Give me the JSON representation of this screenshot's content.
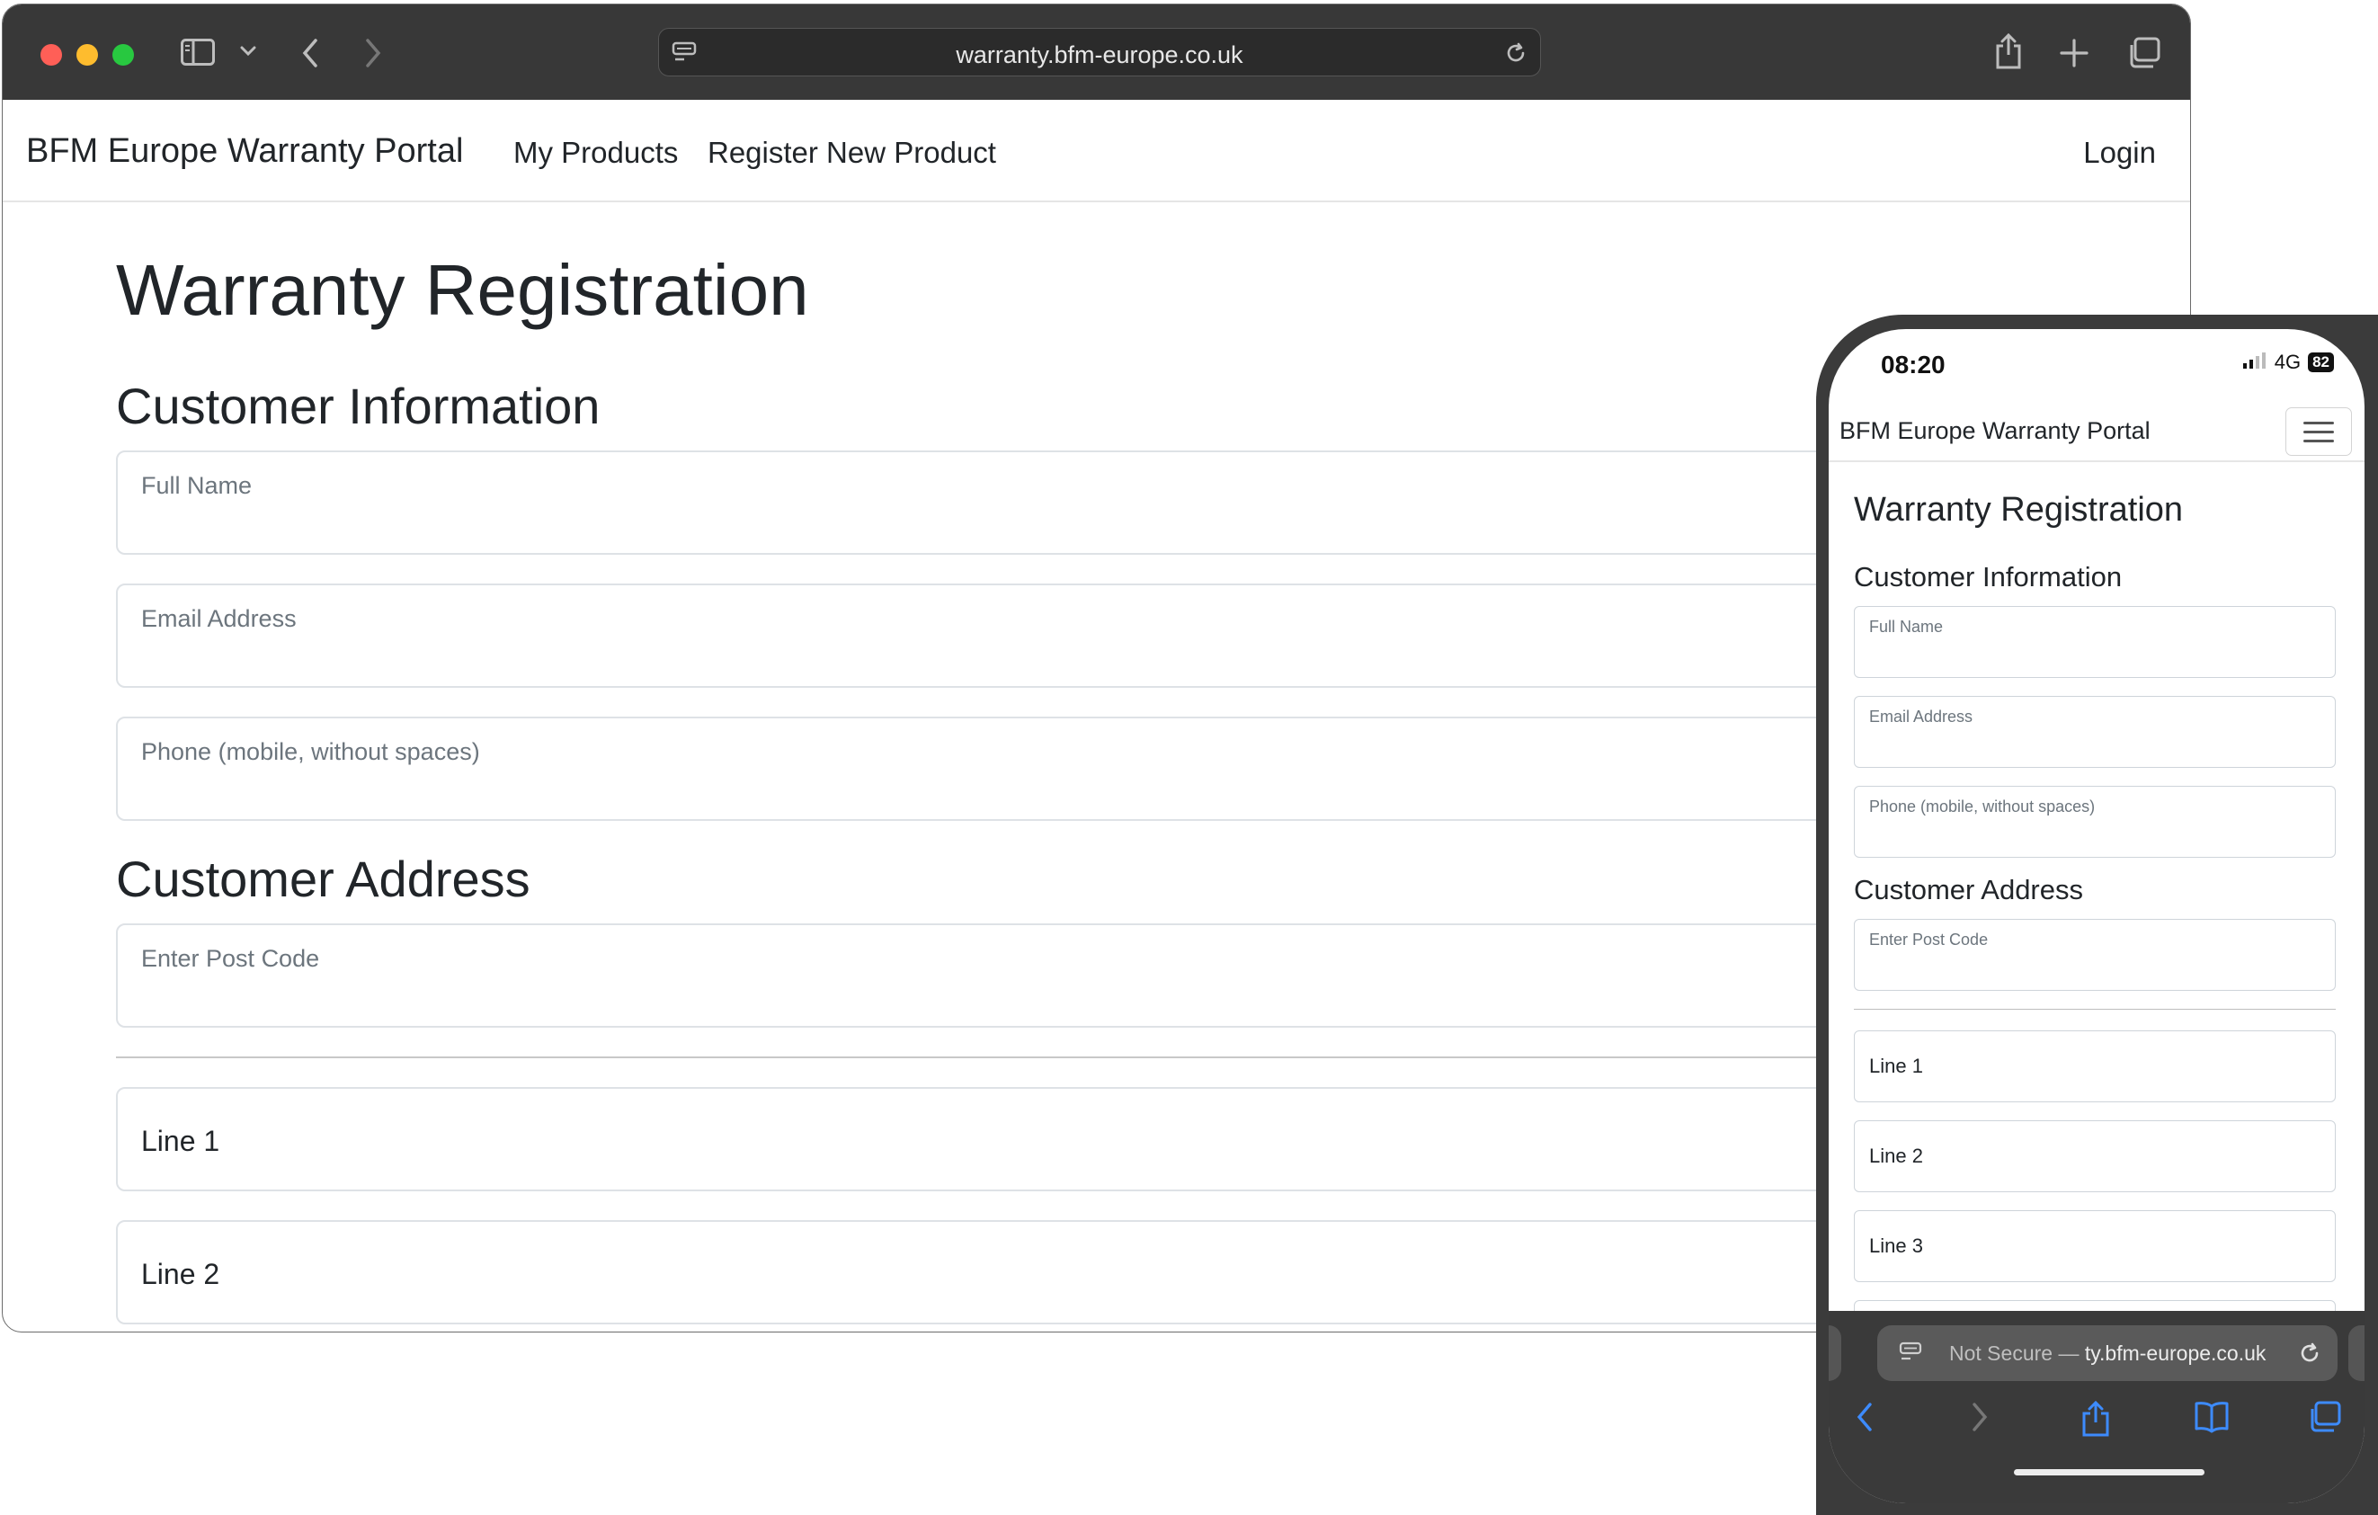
{
  "desktop": {
    "url": "warranty.bfm-europe.co.uk",
    "navbar": {
      "brand": "BFM Europe Warranty Portal",
      "links": [
        "My Products",
        "Register New Product"
      ],
      "login": "Login"
    },
    "page_title": "Warranty Registration",
    "section_customer_info": "Customer Information",
    "fields_customer_info": [
      {
        "placeholder": "Full Name"
      },
      {
        "placeholder": "Email Address"
      },
      {
        "placeholder": "Phone (mobile, without spaces)"
      }
    ],
    "section_address": "Customer Address",
    "postcode_placeholder": "Enter Post Code",
    "address_lines": [
      "Line 1",
      "Line 2"
    ]
  },
  "phone": {
    "time": "08:20",
    "network": "4G",
    "battery": "82",
    "brand": "BFM Europe Warranty Portal",
    "page_title": "Warranty Registration",
    "section_customer_info": "Customer Information",
    "fields_customer_info": [
      {
        "placeholder": "Full Name"
      },
      {
        "placeholder": "Email Address"
      },
      {
        "placeholder": "Phone (mobile, without spaces)"
      }
    ],
    "section_address": "Customer Address",
    "postcode_placeholder": "Enter Post Code",
    "address_lines": [
      "Line 1",
      "Line 2",
      "Line 3"
    ],
    "url_prefix": "Not Secure — ",
    "url_text": "ty.bfm-europe.co.uk"
  },
  "colors": {
    "toolbar": "#383838",
    "accent_ios": "#3d8bfd",
    "text": "#212529",
    "placeholder": "#6c757d"
  }
}
